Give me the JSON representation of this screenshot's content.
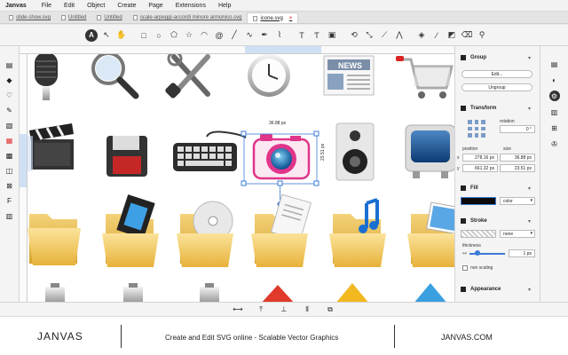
{
  "app": {
    "brand": "Janvas",
    "menus": [
      "File",
      "Edit",
      "Object",
      "Create",
      "Page",
      "Extensions",
      "Help"
    ]
  },
  "tabs": [
    {
      "label": "slide-show.svg",
      "active": false
    },
    {
      "label": "Untitled",
      "active": false
    },
    {
      "label": "Untitled",
      "active": false
    },
    {
      "label": "scale-arpeggi-accordi minore armonico.svg",
      "active": false
    },
    {
      "label": "icone.svg",
      "active": true
    }
  ],
  "tab_close_glyph": "×",
  "toolbar": {
    "selected_tool_glyph": "A",
    "tools": [
      "select-tool",
      "node-tool",
      "hand-tool",
      "rectangle-tool",
      "ellipse-tool",
      "polygon-tool",
      "star-tool",
      "arc-tool",
      "spiral-tool",
      "line-tool",
      "freehand-tool",
      "pen-tool",
      "path-tool",
      "text-tool",
      "text-path-tool",
      "image-tool",
      "rotate-tool",
      "scale-tool",
      "skew-tool",
      "fill-tool",
      "eyedropper-tool",
      "gradient-tool",
      "eraser-tool",
      "magnifier-tool"
    ]
  },
  "canvas": {
    "selection": {
      "width_label": "36.88 px",
      "height_label": "23.51 px"
    }
  },
  "panel": {
    "group": {
      "title": "Group",
      "edit_label": "Edit...",
      "ungroup_label": "Ungroup"
    },
    "transform": {
      "title": "Transform",
      "rotation_label": "rotation",
      "rotation_value": "0 °",
      "position_label": "position",
      "size_label": "size",
      "x_label": "x",
      "y_label": "y",
      "x_value": "278.16 px",
      "y_value": "661.32 px",
      "width_value": "36.88 px",
      "height_value": "23.51 px"
    },
    "fill": {
      "title": "Fill",
      "mode": "color",
      "swatch_color": "#0a0a0a"
    },
    "stroke": {
      "title": "Stroke",
      "mode": "none",
      "thickness_label": "thickness",
      "thickness_value": "1 px",
      "nonscaling_label": "non scaling"
    },
    "appearance": {
      "title": "Appearance"
    }
  },
  "footer": {
    "logo": "JANVAS",
    "tagline": "Create and Edit SVG online - Scalable Vector Graphics",
    "url": "JANVAS.COM"
  },
  "colors": {
    "accent_pink": "#e0358a",
    "selection_blue": "#3a7bd5",
    "folder_yellow": "#f3cd5a",
    "highlight_blue": "#cfe0f5"
  },
  "icons_on_canvas": [
    "microphone-icon",
    "magnifier-icon",
    "tools-icon",
    "clock-icon",
    "news-icon",
    "shopping-cart-icon",
    "clapperboard-icon",
    "floppy-disk-icon",
    "keyboard-icon",
    "camera-icon",
    "speaker-icon",
    "tv-icon",
    "folder-icon",
    "video-folder-icon",
    "cd-folder-icon",
    "documents-folder-icon",
    "music-folder-icon",
    "images-folder-icon"
  ]
}
